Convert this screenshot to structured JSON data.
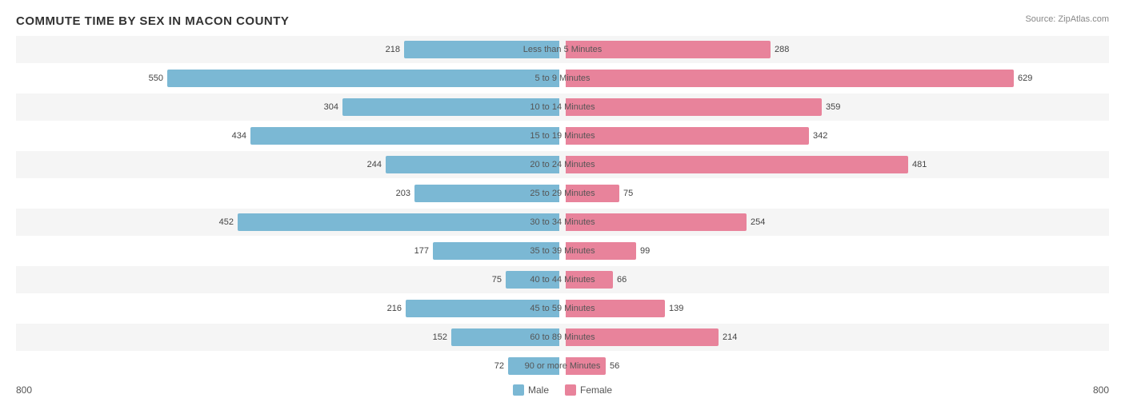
{
  "title": "COMMUTE TIME BY SEX IN MACON COUNTY",
  "source": "Source: ZipAtlas.com",
  "axis_min": "800",
  "axis_max": "800",
  "colors": {
    "male": "#7bb8d4",
    "female": "#e8839b"
  },
  "legend": {
    "male_label": "Male",
    "female_label": "Female"
  },
  "rows": [
    {
      "label": "Less than 5 Minutes",
      "male": 218,
      "female": 288,
      "male_pct": 34,
      "female_pct": 36
    },
    {
      "label": "5 to 9 Minutes",
      "male": 550,
      "female": 629,
      "male_pct": 68,
      "female_pct": 78
    },
    {
      "label": "10 to 14 Minutes",
      "male": 304,
      "female": 359,
      "male_pct": 37,
      "female_pct": 44
    },
    {
      "label": "15 to 19 Minutes",
      "male": 434,
      "female": 342,
      "male_pct": 53,
      "female_pct": 42
    },
    {
      "label": "20 to 24 Minutes",
      "male": 244,
      "female": 481,
      "male_pct": 30,
      "female_pct": 59
    },
    {
      "label": "25 to 29 Minutes",
      "male": 203,
      "female": 75,
      "male_pct": 25,
      "female_pct": 9
    },
    {
      "label": "30 to 34 Minutes",
      "male": 452,
      "female": 254,
      "male_pct": 55,
      "female_pct": 31
    },
    {
      "label": "35 to 39 Minutes",
      "male": 177,
      "female": 99,
      "male_pct": 22,
      "female_pct": 12
    },
    {
      "label": "40 to 44 Minutes",
      "male": 75,
      "female": 66,
      "male_pct": 9,
      "female_pct": 8
    },
    {
      "label": "45 to 59 Minutes",
      "male": 216,
      "female": 139,
      "male_pct": 26,
      "female_pct": 17
    },
    {
      "label": "60 to 89 Minutes",
      "male": 152,
      "female": 214,
      "male_pct": 18,
      "female_pct": 26
    },
    {
      "label": "90 or more Minutes",
      "male": 72,
      "female": 56,
      "male_pct": 8,
      "female_pct": 7
    }
  ]
}
